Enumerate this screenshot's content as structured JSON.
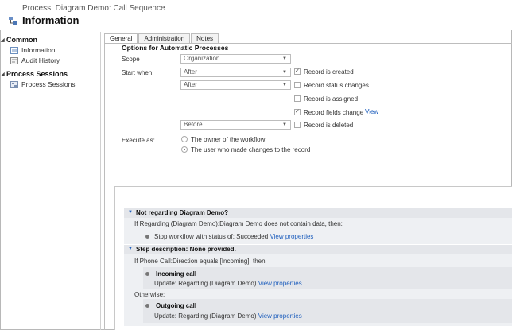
{
  "header": {
    "subtitle": "Process: Diagram Demo: Call Sequence",
    "title": "Information"
  },
  "sidebar": {
    "common_label": "Common",
    "common_items": [
      {
        "label": "Information"
      },
      {
        "label": "Audit History"
      }
    ],
    "sessions_label": "Process Sessions",
    "sessions_items": [
      {
        "label": "Process Sessions"
      }
    ]
  },
  "tabs": [
    {
      "label": "General"
    },
    {
      "label": "Administration"
    },
    {
      "label": "Notes"
    }
  ],
  "options": {
    "title": "Options for Automatic Processes",
    "scope_label": "Scope",
    "scope_value": "Organization",
    "start_label": "Start when:",
    "select_1": "After",
    "select_2": "After",
    "select_3": "Before",
    "checks": [
      {
        "label": "Record is created",
        "checked": true
      },
      {
        "label": "Record status changes",
        "checked": false
      },
      {
        "label": "Record is assigned",
        "checked": false
      },
      {
        "label": "Record fields change",
        "checked": true,
        "link": "View"
      },
      {
        "label": "Record is deleted",
        "checked": false
      }
    ],
    "execute_label": "Execute as:",
    "radio_1": "The owner of the workflow",
    "radio_2": "The user who made changes to the record"
  },
  "designer": {
    "step1_title": "Not regarding Diagram Demo?",
    "step1_cond": "If Regarding (Diagram Demo):Diagram Demo does not contain data, then:",
    "step1_action": "Stop workflow with status of:",
    "step1_status": "Succeeded",
    "step1_link": "View properties",
    "step2_title": "Step description: None provided.",
    "step2_cond": "If Phone Call:Direction equals [Incoming], then:",
    "incoming_title": "Incoming call",
    "incoming_update": "Update:",
    "incoming_target": "Regarding (Diagram Demo)",
    "incoming_link": "View properties",
    "otherwise": "Otherwise:",
    "outgoing_title": "Outgoing call",
    "outgoing_update": "Update:",
    "outgoing_target": "Regarding (Diagram Demo)",
    "outgoing_link": "View properties"
  }
}
